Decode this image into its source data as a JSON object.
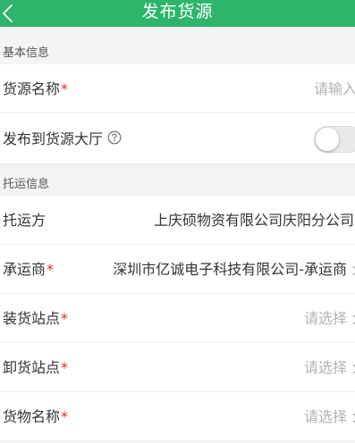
{
  "header": {
    "title": "发布货源",
    "back_icon": "chevron-left-icon"
  },
  "colors": {
    "primary": "#2db56b",
    "required": "#e0262b",
    "placeholder": "#b3b3b3"
  },
  "sections": {
    "basic": {
      "title": "基本信息"
    },
    "shipping": {
      "title": "托运信息"
    }
  },
  "fields": {
    "cargo_name": {
      "label": "货源名称",
      "required_mark": "*",
      "placeholder": "请输入"
    },
    "publish_hall": {
      "label": "发布到货源大厅",
      "help_icon": "question-circle-icon",
      "enabled": false
    },
    "shipper": {
      "label": "托运方",
      "value": "上庆硕物资有限公司庆阳分公司"
    },
    "carrier": {
      "label": "承运商",
      "required_mark": "*",
      "value": "深圳市亿诚电子科技有限公司-承运商"
    },
    "loading_site": {
      "label": "装货站点",
      "required_mark": "*",
      "placeholder": "请选择"
    },
    "unloading_site": {
      "label": "卸货站点",
      "required_mark": "*",
      "placeholder": "请选择"
    },
    "goods_name": {
      "label": "货物名称",
      "required_mark": "*",
      "placeholder": "请选择"
    }
  }
}
